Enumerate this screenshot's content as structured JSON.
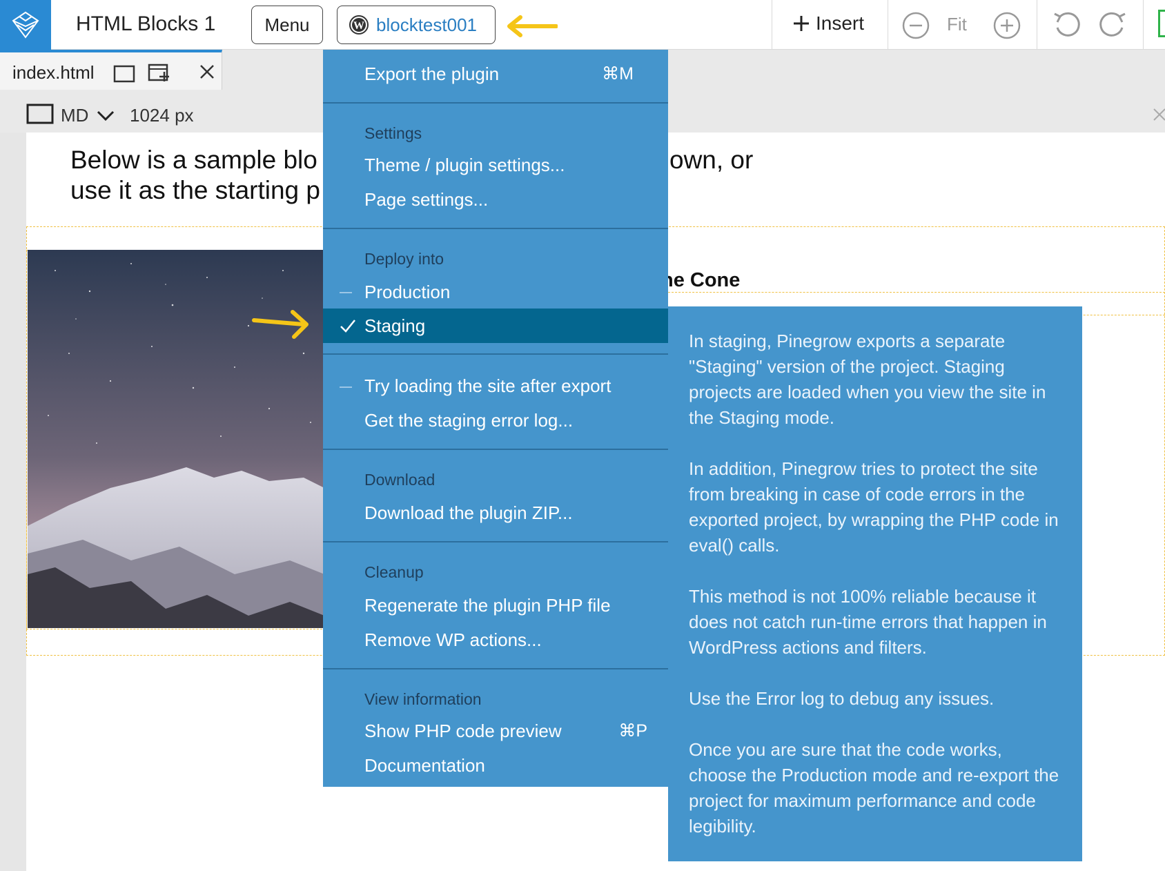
{
  "toolbar": {
    "app_title": "HTML Blocks 1",
    "menu_label": "Menu",
    "site_label": "blocktest001",
    "insert_label": "Insert",
    "fit_label": "Fit",
    "logo_icon": "pinegrow-logo-icon",
    "accent_color": "#2a8ad3"
  },
  "tab": {
    "label": "index.html"
  },
  "viewport": {
    "size_label": "MD",
    "width_label": "1024 px"
  },
  "page": {
    "text_line1": "Below is a sample blo",
    "text_line1_right": "own, or",
    "text_line2": "use it as the starting p",
    "heading_fragment": "ne Cone"
  },
  "menu": {
    "export": "Export the plugin",
    "export_shortcut": "⌘M",
    "settings_header": "Settings",
    "theme_settings": "Theme / plugin settings...",
    "page_settings": "Page settings...",
    "deploy_header": "Deploy into",
    "production": "Production",
    "staging": "Staging",
    "try_loading": "Try loading the site after export",
    "staging_log": "Get the staging error log...",
    "download_header": "Download",
    "download_zip": "Download the plugin ZIP...",
    "cleanup_header": "Cleanup",
    "regenerate": "Regenerate the plugin PHP file",
    "remove_actions": "Remove WP actions...",
    "view_header": "View information",
    "php_preview": "Show PHP code preview",
    "php_preview_shortcut": "⌘P",
    "documentation": "Documentation",
    "menu_bg": "#4595cc",
    "selected_bg": "#04668f"
  },
  "tooltip": {
    "p1": "In staging, Pinegrow exports a separate \"Staging\" version of the project. Staging projects are loaded when you view the site in the Staging mode.",
    "p2": "In addition, Pinegrow tries to protect the site from breaking in case of code errors in the exported project, by wrapping the PHP code in eval() calls.",
    "p3": "This method is not 100% reliable because it does not catch run-time errors that happen in WordPress actions and filters.",
    "p4": "Use the Error log to debug any issues.",
    "p5": "Once you are sure that the code works, choose the Production mode and re-export the project for maximum performance and code legibility."
  }
}
